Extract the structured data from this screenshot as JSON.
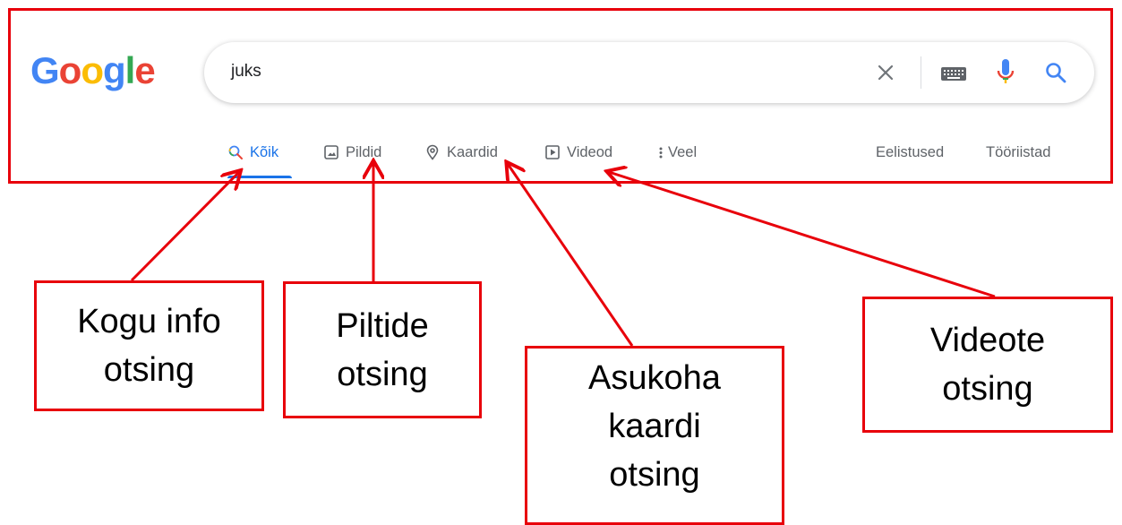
{
  "logo": {
    "letters": [
      "G",
      "o",
      "o",
      "g",
      "l",
      "e"
    ]
  },
  "search": {
    "query": "juks"
  },
  "tabs": [
    {
      "label": "Kõik",
      "icon": "search-icon",
      "active": true
    },
    {
      "label": "Pildid",
      "icon": "image-icon"
    },
    {
      "label": "Kaardid",
      "icon": "location-pin-icon"
    },
    {
      "label": "Videod",
      "icon": "play-icon"
    },
    {
      "label": "Veel",
      "icon": "more-vert-icon"
    }
  ],
  "tools": {
    "preferences": "Eelistused",
    "tools": "Tööriistad"
  },
  "callouts": [
    {
      "line1": "Kogu info",
      "line2": "otsing"
    },
    {
      "line1": "Piltide",
      "line2": "otsing"
    },
    {
      "line1": "Asukoha",
      "line2": "kaardi",
      "line3": "otsing"
    },
    {
      "line1": "Videote",
      "line2": "otsing"
    }
  ],
  "colors": {
    "annotation": "#e8000b",
    "active_tab": "#1a73e8",
    "inactive_tab": "#5f6368"
  }
}
